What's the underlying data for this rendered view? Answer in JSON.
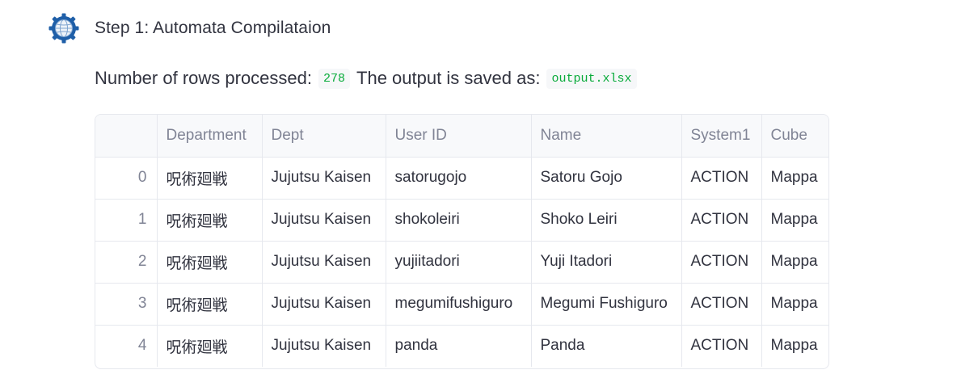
{
  "step": {
    "title": "Step 1: Automata Compilataion",
    "avatar_icon": "gear-globe-icon",
    "avatar_colors": {
      "gear": "#1f5fa8",
      "globe": "#e8eef6"
    }
  },
  "summary": {
    "rows_label": "Number of rows processed:",
    "rows_count": "278",
    "output_label": "The output is saved as:",
    "output_file": "output.xlsx"
  },
  "table": {
    "columns": [
      "",
      "Department",
      "Dept",
      "User ID",
      "Name",
      "System1",
      "Cube"
    ],
    "rows": [
      [
        "0",
        "呪術廻戦",
        "Jujutsu Kaisen",
        "satorugojo",
        "Satoru Gojo",
        "ACTION",
        "Mappa"
      ],
      [
        "1",
        "呪術廻戦",
        "Jujutsu Kaisen",
        "shokoleiri",
        "Shoko Leiri",
        "ACTION",
        "Mappa"
      ],
      [
        "2",
        "呪術廻戦",
        "Jujutsu Kaisen",
        "yujiitadori",
        "Yuji Itadori",
        "ACTION",
        "Mappa"
      ],
      [
        "3",
        "呪術廻戦",
        "Jujutsu Kaisen",
        "megumifushiguro",
        "Megumi Fushiguro",
        "ACTION",
        "Mappa"
      ],
      [
        "4",
        "呪術廻戦",
        "Jujutsu Kaisen",
        "panda",
        "Panda",
        "ACTION",
        "Mappa"
      ]
    ]
  }
}
